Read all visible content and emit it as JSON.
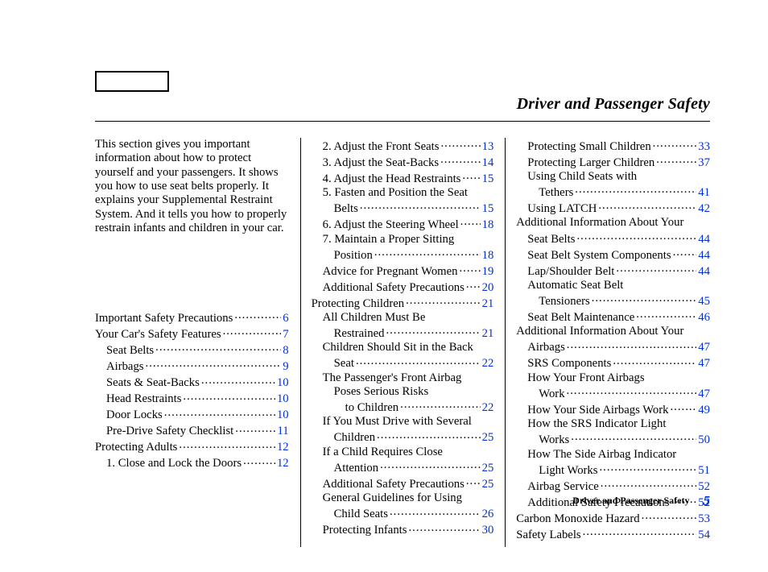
{
  "section_title": "Driver and Passenger Safety",
  "intro": "This section gives you important information about how to protect yourself and your passengers. It shows you how to use seat belts properly. It explains your Supplemental Restraint System. And it tells you how to properly restrain infants and children in your car.",
  "footer": {
    "label": "Driver and Passenger Safety",
    "page": "5"
  },
  "columns": [
    [
      {
        "label": "Important Safety Precautions",
        "page": "6",
        "indent": 0
      },
      {
        "label": "Your Car's Safety Features",
        "page": "7",
        "indent": 0
      },
      {
        "label": "Seat Belts",
        "page": "8",
        "indent": 1
      },
      {
        "label": "Airbags",
        "page": "9",
        "indent": 1
      },
      {
        "label": "Seats & Seat-Backs",
        "page": "10",
        "indent": 1
      },
      {
        "label": "Head Restraints",
        "page": "10",
        "indent": 1
      },
      {
        "label": "Door Locks",
        "page": "10",
        "indent": 1
      },
      {
        "label": "Pre-Drive Safety Checklist",
        "page": "11",
        "indent": 1
      },
      {
        "label": "Protecting Adults",
        "page": "12",
        "indent": 0
      },
      {
        "label": "1. Close and Lock the Doors",
        "page": "12",
        "indent": 1
      }
    ],
    [
      {
        "label": "2. Adjust the Front Seats",
        "page": "13",
        "indent": 1
      },
      {
        "label": "3. Adjust the Seat-Backs",
        "page": "14",
        "indent": 1
      },
      {
        "label": "4. Adjust the Head Restraints",
        "page": "15",
        "indent": 1
      },
      {
        "label": "5. Fasten and Position the Seat",
        "cont": true,
        "indent": 1
      },
      {
        "label": "Belts",
        "page": "15",
        "indent": 2
      },
      {
        "label": "6. Adjust the Steering Wheel",
        "page": "18",
        "indent": 1
      },
      {
        "label": "7. Maintain a Proper Sitting",
        "cont": true,
        "indent": 1
      },
      {
        "label": "Position",
        "page": "18",
        "indent": 2
      },
      {
        "label": "Advice for Pregnant Women",
        "page": "19",
        "indent": 1
      },
      {
        "label": "Additional Safety Precautions",
        "page": "20",
        "indent": 1
      },
      {
        "label": "Protecting Children",
        "page": "21",
        "indent": 0
      },
      {
        "label": "All Children Must Be",
        "cont": true,
        "indent": 1
      },
      {
        "label": "Restrained",
        "page": "21",
        "indent": 2
      },
      {
        "label": "Children Should Sit in the Back",
        "cont": true,
        "indent": 1
      },
      {
        "label": "Seat",
        "page": "22",
        "indent": 2
      },
      {
        "label": "The Passenger's Front Airbag",
        "cont": true,
        "indent": 1
      },
      {
        "label": "Poses Serious Risks",
        "cont": true,
        "indent": 2
      },
      {
        "label": "to Children",
        "page": "22",
        "indent": 3
      },
      {
        "label": "If You Must Drive with Several",
        "cont": true,
        "indent": 1
      },
      {
        "label": "Children",
        "page": "25",
        "indent": 2
      },
      {
        "label": "If a Child Requires Close",
        "cont": true,
        "indent": 1
      },
      {
        "label": "Attention",
        "page": "25",
        "indent": 2
      },
      {
        "label": "Additional Safety Precautions",
        "page": "25",
        "indent": 1
      },
      {
        "label": "General Guidelines for Using",
        "cont": true,
        "indent": 1
      },
      {
        "label": "Child Seats",
        "page": "26",
        "indent": 2
      },
      {
        "label": "Protecting Infants",
        "page": "30",
        "indent": 1
      }
    ],
    [
      {
        "label": "Protecting Small Children",
        "page": "33",
        "indent": 1
      },
      {
        "label": "Protecting Larger Children",
        "page": "37",
        "indent": 1
      },
      {
        "label": "Using Child Seats with",
        "cont": true,
        "indent": 1
      },
      {
        "label": "Tethers",
        "page": "41",
        "indent": 2
      },
      {
        "label": "Using LATCH",
        "page": "42",
        "indent": 1
      },
      {
        "label": "Additional Information About Your",
        "cont": true,
        "indent": 0
      },
      {
        "label": "Seat Belts",
        "page": "44",
        "indent": 1
      },
      {
        "label": "Seat Belt System Components",
        "page": "44",
        "indent": 1
      },
      {
        "label": "Lap/Shoulder Belt",
        "page": "44",
        "indent": 1
      },
      {
        "label": "Automatic Seat Belt",
        "cont": true,
        "indent": 1
      },
      {
        "label": "Tensioners",
        "page": "45",
        "indent": 2
      },
      {
        "label": "Seat Belt Maintenance",
        "page": "46",
        "indent": 1
      },
      {
        "label": "Additional Information About Your",
        "cont": true,
        "indent": 0
      },
      {
        "label": "Airbags",
        "page": "47",
        "indent": 1
      },
      {
        "label": "SRS Components",
        "page": "47",
        "indent": 1
      },
      {
        "label": "How Your Front Airbags",
        "cont": true,
        "indent": 1
      },
      {
        "label": "Work",
        "page": "47",
        "indent": 2
      },
      {
        "label": "How Your Side Airbags Work",
        "page": "49",
        "indent": 1
      },
      {
        "label": "How the SRS Indicator Light",
        "cont": true,
        "indent": 1
      },
      {
        "label": "Works",
        "page": "50",
        "indent": 2
      },
      {
        "label": "How The Side Airbag Indicator",
        "cont": true,
        "indent": 1
      },
      {
        "label": "Light Works",
        "page": "51",
        "indent": 2
      },
      {
        "label": "Airbag Service",
        "page": "52",
        "indent": 1
      },
      {
        "label": "Additional Safety Precautions",
        "page": "52",
        "indent": 1
      },
      {
        "label": "Carbon Monoxide Hazard",
        "page": "53",
        "indent": 0
      },
      {
        "label": "Safety Labels",
        "page": "54",
        "indent": 0
      }
    ]
  ]
}
